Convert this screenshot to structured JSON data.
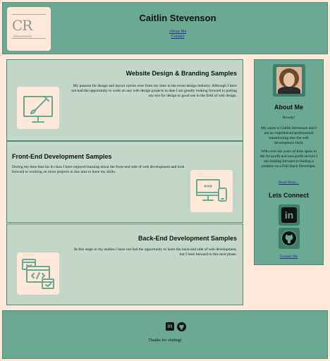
{
  "header": {
    "logo_monogram": "CR",
    "logo_signature": "Stevenson",
    "name": "Caitlin Stevenson",
    "nav": [
      "About Me",
      "Contact"
    ]
  },
  "sections": [
    {
      "title": "Website Design & Branding Samples",
      "body": "My passion for design and layout carries over from my time in the event design industry. Although I have not had the opportunity to work on any web design projects to date I am greatly looking forward to putting my eye for design to good use in the field of web design.",
      "icon": "design-easel-icon"
    },
    {
      "title": "Front-End Development Samples",
      "body": "During my time thus far in class I have enjoyed learning about the front-end side of web development and look forward to working on more projects in this area to hone my skills.",
      "icon": "devices-icon"
    },
    {
      "title": "Back-End Development Samples",
      "body": "At this stage in my studies I have not had the opportunity to learn the back-end side of web development, but I look forward to this next phase.",
      "icon": "code-windows-icon"
    }
  ],
  "sidebar": {
    "about_title": "About Me",
    "greeting": "Howdy!",
    "intro": "My name is Caitlin Stevenson and I am an experienced professional transitioning into the web development field.",
    "bio": "With over ten years of time spent in the for-profit and non-profit sectors I am looking forward to finding a position as a Full Stack Developer.",
    "read_more": "Read More...",
    "connect_title": "Lets Connect",
    "linkedin_glyph": "in",
    "contact_link": "Contact Me"
  },
  "footer": {
    "linkedin_glyph": "in",
    "thanks": "Thanks for visiting!"
  },
  "colors": {
    "background": "#fde8d9",
    "header_green": "#6aa892",
    "card_green": "#c2d7c7",
    "icon_stroke": "#6aa892"
  }
}
